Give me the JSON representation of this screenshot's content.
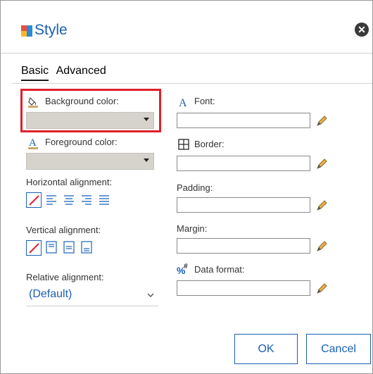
{
  "dialog": {
    "title": "Style",
    "close_icon": "close-icon"
  },
  "tabs": [
    {
      "label": "Basic",
      "active": true
    },
    {
      "label": "Advanced",
      "active": false
    }
  ],
  "left": {
    "background_color_label": "Background color:",
    "foreground_color_label": "Foreground color:",
    "horizontal_alignment_label": "Horizontal alignment:",
    "vertical_alignment_label": "Vertical alignment:",
    "relative_alignment_label": "Relative alignment:",
    "relative_alignment_value": "(Default)"
  },
  "right": {
    "font_label": "Font:",
    "border_label": "Border:",
    "padding_label": "Padding:",
    "margin_label": "Margin:",
    "data_format_label": "Data format:"
  },
  "buttons": {
    "ok": "OK",
    "cancel": "Cancel"
  },
  "colors": {
    "accent": "#1a5fb4",
    "highlight": "#e0202a",
    "swatch": "#d6d3cd"
  }
}
